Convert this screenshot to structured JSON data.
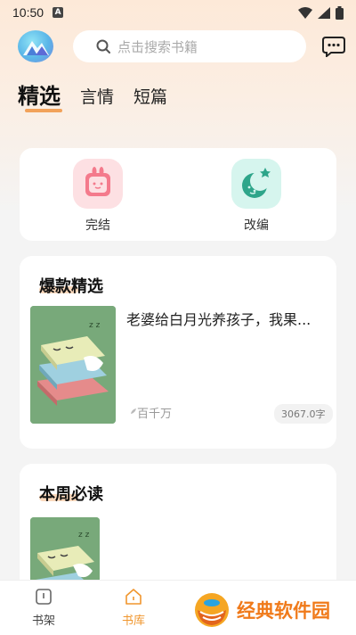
{
  "status_bar": {
    "time": "10:50",
    "notification_letter": "A"
  },
  "search": {
    "placeholder": "点击搜索书籍"
  },
  "tabs": [
    {
      "label": "精选",
      "active": true
    },
    {
      "label": "言情",
      "active": false
    },
    {
      "label": "短篇",
      "active": false
    }
  ],
  "categories": [
    {
      "label": "完结",
      "icon": "rabbit-book-icon",
      "bg": "#fde0e3"
    },
    {
      "label": "改编",
      "icon": "moon-stars-icon",
      "bg": "#d6f5ee"
    }
  ],
  "sections": [
    {
      "title": "爆款精选",
      "book": {
        "title": "老婆给白月光养孩子，我果...",
        "author": "百千万",
        "words": "3067.0字"
      }
    },
    {
      "title": "本周必读"
    }
  ],
  "bottom_nav": [
    {
      "label": "书架",
      "icon": "bookshelf-icon",
      "active": false
    },
    {
      "label": "书库",
      "icon": "library-home-icon",
      "active": true
    }
  ],
  "watermark": {
    "text": "经典软件园"
  },
  "colors": {
    "accent": "#f2a25a",
    "active_nav": "#f0962e",
    "watermark": "#f07a1a"
  }
}
